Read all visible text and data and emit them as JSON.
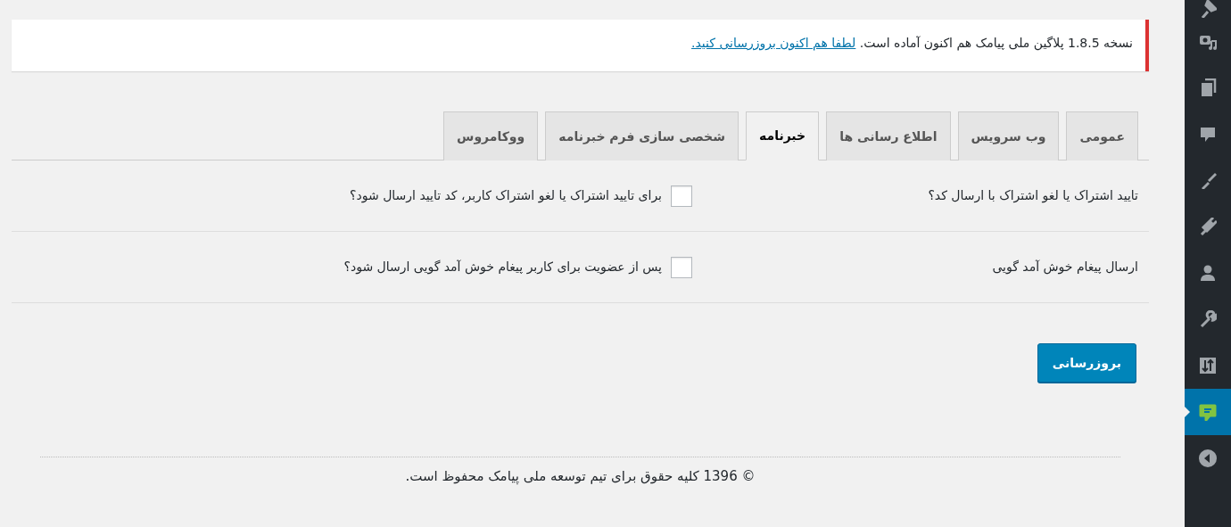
{
  "notice": {
    "text": "نسخه 1.8.5 پلاگین ملی پیامک هم اکنون آماده است.",
    "link": "لطفا هم اکنون بروزرسانی کنید."
  },
  "tabs": [
    {
      "label": "عمومی",
      "selected": false
    },
    {
      "label": "وب سرویس",
      "selected": false
    },
    {
      "label": "اطلاع رسانی ها",
      "selected": false
    },
    {
      "label": "خبرنامه",
      "selected": true
    },
    {
      "label": "شخصی سازی فرم خبرنامه",
      "selected": false
    },
    {
      "label": "ووکامروس",
      "selected": false
    }
  ],
  "settings": [
    {
      "label": "تایید اشتراک یا لغو اشتراک با ارسال کد؟",
      "checked": false,
      "description": "برای تایید اشتراک یا لغو اشتراک کاربر، کد تایید ارسال شود؟"
    },
    {
      "label": "ارسال پیغام خوش آمد گویی",
      "checked": false,
      "description": "پس از عضویت برای کاربر پیغام خوش آمد گویی ارسال شود؟"
    }
  ],
  "submit_button": "بروزرسانی",
  "footer": "© 1396 کلیه حقوق برای تیم توسعه ملی پیامک محفوظ است.",
  "admin_menu": [
    {
      "selected": false
    },
    {
      "selected": false
    },
    {
      "selected": false
    },
    {
      "selected": false
    },
    {
      "selected": false
    },
    {
      "selected": false
    },
    {
      "selected": false
    },
    {
      "selected": false
    },
    {
      "selected": false
    },
    {
      "selected": true
    }
  ]
}
